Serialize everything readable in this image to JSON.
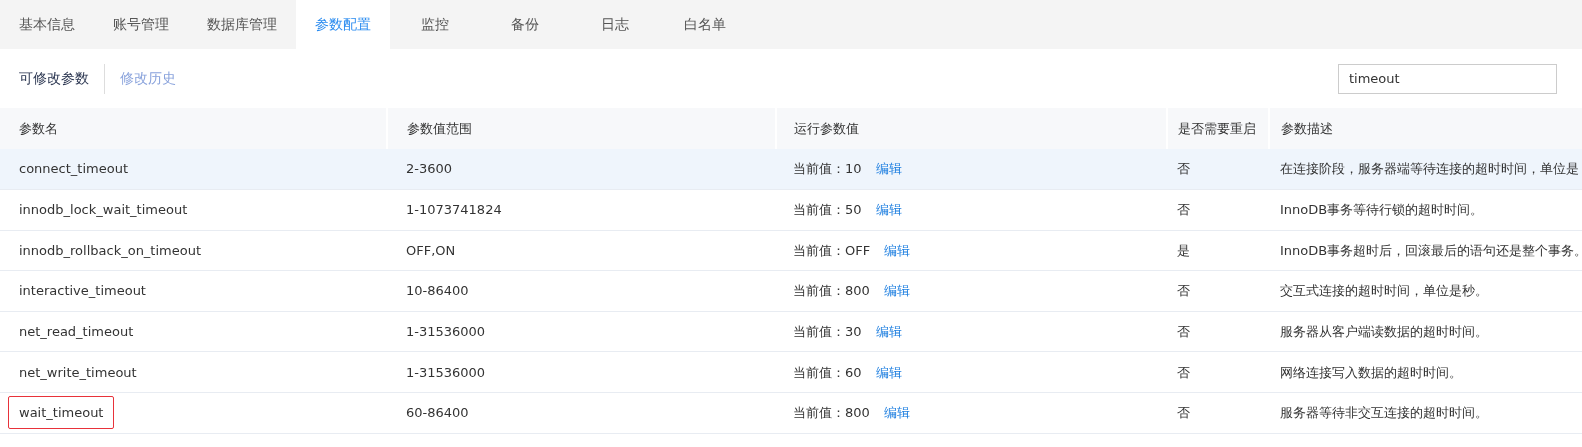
{
  "tabs": [
    {
      "label": "基本信息",
      "selected": false
    },
    {
      "label": "账号管理",
      "selected": false
    },
    {
      "label": "数据库管理",
      "selected": false
    },
    {
      "label": "参数配置",
      "selected": true
    },
    {
      "label": "监控",
      "selected": false
    },
    {
      "label": "备份",
      "selected": false
    },
    {
      "label": "日志",
      "selected": false
    },
    {
      "label": "白名单",
      "selected": false
    }
  ],
  "subtabs": [
    {
      "label": "可修改参数",
      "selected": true
    },
    {
      "label": "修改历史",
      "selected": false
    }
  ],
  "search": {
    "value": "timeout"
  },
  "table": {
    "columns": [
      "参数名",
      "参数值范围",
      "运行参数值",
      "是否需要重启",
      "参数描述"
    ],
    "rows": [
      {
        "name": "connect_timeout",
        "range": "2-3600",
        "current_label": "当前值：",
        "current": "10",
        "edit": "编辑",
        "restart": "否",
        "description": "在连接阶段，服务器端等待连接的超时时间，单位是",
        "selected": true,
        "marked": false
      },
      {
        "name": "innodb_lock_wait_timeout",
        "range": "1-1073741824",
        "current_label": "当前值：",
        "current": "50",
        "edit": "编辑",
        "restart": "否",
        "description": "InnoDB事务等待行锁的超时时间。",
        "selected": false,
        "marked": false
      },
      {
        "name": "innodb_rollback_on_timeout",
        "range": "OFF,ON",
        "current_label": "当前值：",
        "current": "OFF",
        "edit": "编辑",
        "restart": "是",
        "description": "InnoDB事务超时后，回滚最后的语句还是整个事务。",
        "selected": false,
        "marked": false
      },
      {
        "name": "interactive_timeout",
        "range": "10-86400",
        "current_label": "当前值：",
        "current": "800",
        "edit": "编辑",
        "restart": "否",
        "description": "交互式连接的超时时间，单位是秒。",
        "selected": false,
        "marked": false
      },
      {
        "name": "net_read_timeout",
        "range": "1-31536000",
        "current_label": "当前值：",
        "current": "30",
        "edit": "编辑",
        "restart": "否",
        "description": "服务器从客户端读数据的超时时间。",
        "selected": false,
        "marked": false
      },
      {
        "name": "net_write_timeout",
        "range": "1-31536000",
        "current_label": "当前值：",
        "current": "60",
        "edit": "编辑",
        "restart": "否",
        "description": "网络连接写入数据的超时时间。",
        "selected": false,
        "marked": false
      },
      {
        "name": "wait_timeout",
        "range": "60-86400",
        "current_label": "当前值：",
        "current": "800",
        "edit": "编辑",
        "restart": "否",
        "description": "服务器等待非交互连接的超时时间。",
        "selected": false,
        "marked": true
      }
    ]
  }
}
